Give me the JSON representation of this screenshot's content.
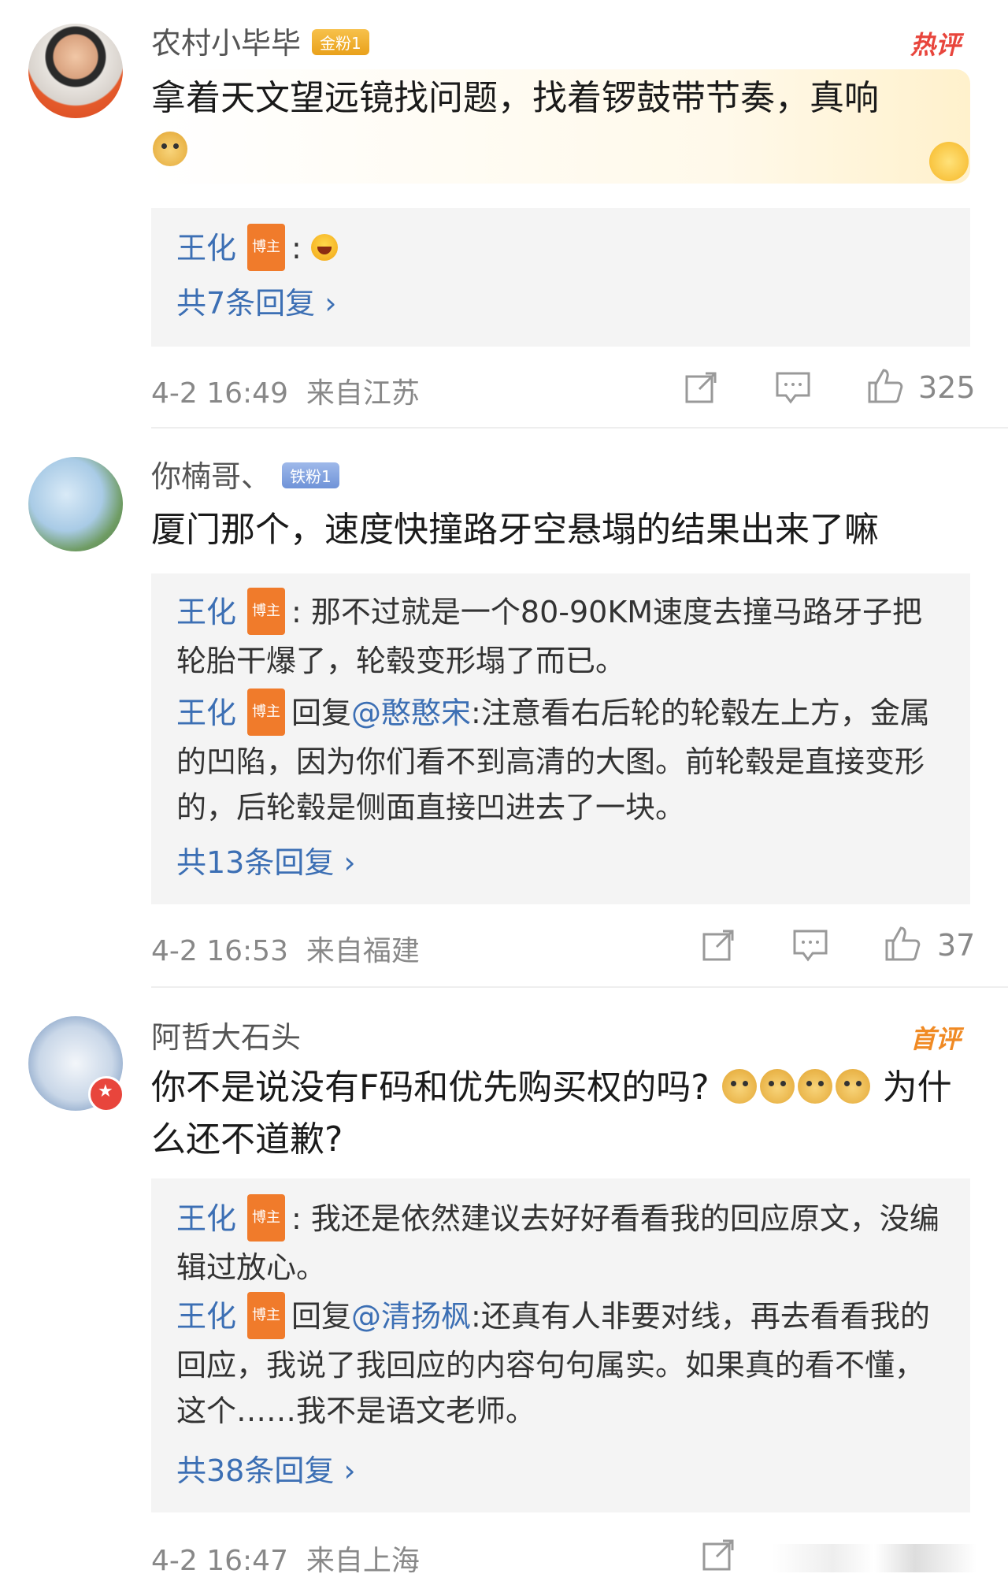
{
  "comments": [
    {
      "username": "农村小毕毕",
      "fan_badge": "金粉1",
      "tag": "热评",
      "text": "拿着天文望远镜找问题，找着锣鼓带节奏，真响",
      "replies": [
        {
          "author": "王化",
          "role_badge": "博主",
          "text": ":"
        }
      ],
      "more_replies": "共7条回复 ›",
      "time": "4-2 16:49",
      "location": "来自江苏",
      "likes": "325"
    },
    {
      "username": "你楠哥、",
      "fan_badge": "铁粉1",
      "text": "厦门那个，速度快撞路牙空悬塌的结果出来了嘛",
      "replies": [
        {
          "author": "王化",
          "role_badge": "博主",
          "text": ": 那不过就是一个80-90KM速度去撞马路牙子把轮胎干爆了，轮毂变形塌了而已。"
        },
        {
          "author": "王化",
          "role_badge": "博主",
          "reply_prefix": "回复",
          "mention": "@憨憨宋",
          "text": ":注意看右后轮的轮毂左上方，金属的凹陷，因为你们看不到高清的大图。前轮毂是直接变形的，后轮毂是侧面直接凹进去了一块。"
        }
      ],
      "more_replies": "共13条回复 ›",
      "time": "4-2 16:53",
      "location": "来自福建",
      "likes": "37"
    },
    {
      "username": "阿哲大石头",
      "tag": "首评",
      "text_part1": "你不是说没有F码和优先购买权的吗?",
      "text_part2": "为什么还不道歉?",
      "replies": [
        {
          "author": "王化",
          "role_badge": "博主",
          "text": ": 我还是依然建议去好好看看我的回应原文，没编辑过放心。"
        },
        {
          "author": "王化",
          "role_badge": "博主",
          "reply_prefix": "回复",
          "mention": "@清扬枫",
          "text": ":还真有人非要对线，再去看看我的回应，我说了我回应的内容句句属实。如果真的看不懂，这个……我不是语文老师。"
        }
      ],
      "more_replies": "共38条回复 ›",
      "time": "4-2 16:47",
      "location": "来自上海"
    }
  ],
  "icons": [
    "share-icon",
    "comment-icon",
    "like-icon"
  ],
  "colors": {
    "link": "#3c6fb4",
    "hot_tag": "#e8453c",
    "first_tag": "#f08a24",
    "reply_bg": "#f4f4f4"
  }
}
